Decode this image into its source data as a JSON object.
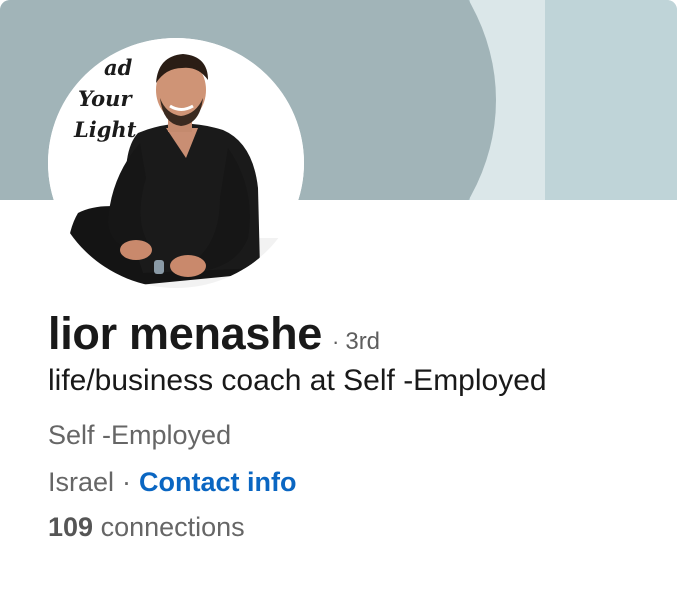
{
  "banner": {
    "colors": {
      "base": "#bed3d7",
      "curve": "#a1b4b8",
      "stripe_light": "#dbe7e9"
    }
  },
  "avatar": {
    "caption_lines": [
      "ad",
      "Your",
      "Light"
    ]
  },
  "profile": {
    "name": "lior menashe",
    "degree_separator": "·",
    "degree": "3rd",
    "headline": "life/business coach at Self -Employed",
    "company": "Self -Employed",
    "location": "Israel",
    "location_separator": "·",
    "contact_info_label": "Contact info",
    "connections_count": "109",
    "connections_label": "connections"
  },
  "colors": {
    "name_text": "#191919",
    "secondary_text": "#666666",
    "link": "#0a66c2"
  }
}
